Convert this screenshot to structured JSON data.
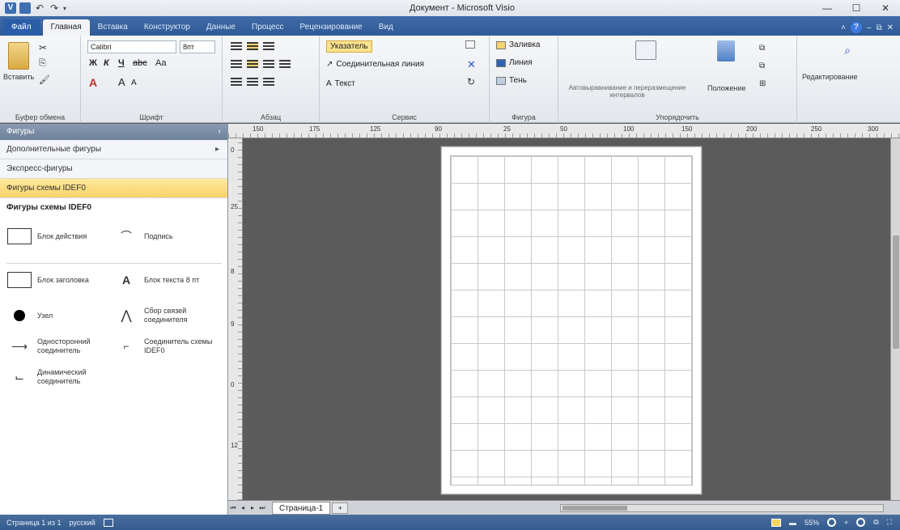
{
  "window": {
    "title": "Документ - Microsoft Visio",
    "min": "—",
    "max": "☐",
    "close": "✕"
  },
  "ribbon_tabs": [
    "Файл",
    "Главная",
    "Вставка",
    "Конструктор",
    "Данные",
    "Процесс",
    "Рецензирование",
    "Вид"
  ],
  "active_tab": "Главная",
  "ribbon": {
    "clipboard": {
      "label": "Буфер обмена",
      "paste": "Вставить"
    },
    "font": {
      "label": "Шрифт",
      "name": "Calibri",
      "size": "8пт",
      "bold": "Ж",
      "italic": "К",
      "underline": "Ч",
      "strike": "abc",
      "case": "Aa",
      "grow": "A",
      "shrink": "A"
    },
    "paragraph": {
      "label": "Абзац"
    },
    "tools": {
      "label": "Сервис",
      "pointer": "Указатель",
      "connector": "Соединительная линия",
      "text": "Текст"
    },
    "shape": {
      "label": "Фигура",
      "fill": "Заливка",
      "line": "Линия",
      "shadow": "Тень"
    },
    "arrange": {
      "label": "Упорядочить",
      "autoalign": "Автовыравнивание и переразмещение интервалов",
      "position": "Положение"
    },
    "editing": {
      "label": "Редактирование"
    }
  },
  "pane": {
    "header": "Фигуры",
    "rows": [
      "Дополнительные фигуры",
      "Экспресс-фигуры",
      "Фигуры схемы IDEF0"
    ],
    "stencil_title": "Фигуры схемы IDEF0",
    "shapes": [
      {
        "label": "Блок действия",
        "icon": "activity-box-icon"
      },
      {
        "label": "Подпись",
        "icon": "annotation-icon"
      },
      {
        "label": "Блок заголовка",
        "icon": "title-box-icon"
      },
      {
        "label": "Блок текста 8 пт",
        "icon": "text-block-icon"
      },
      {
        "label": "Узел",
        "icon": "node-icon"
      },
      {
        "label": "Сбор связей соединителя",
        "icon": "fork-icon"
      },
      {
        "label": "Односторонний соединитель",
        "icon": "one-way-connector-icon"
      },
      {
        "label": "Соединитель схемы IDEF0",
        "icon": "idef0-connector-icon"
      },
      {
        "label": "Динамический соединитель",
        "icon": "dynamic-connector-icon"
      }
    ]
  },
  "rulers": {
    "h": [
      "150",
      "175",
      "125",
      "90",
      "25",
      "50",
      "100",
      "150",
      "200",
      "250",
      "300"
    ],
    "v": [
      "0",
      "25",
      "8",
      "9",
      "0",
      "12"
    ]
  },
  "page_tab": "Страница-1",
  "status": {
    "page": "Страница 1 из 1",
    "language": "русский",
    "zoom": "55%"
  }
}
